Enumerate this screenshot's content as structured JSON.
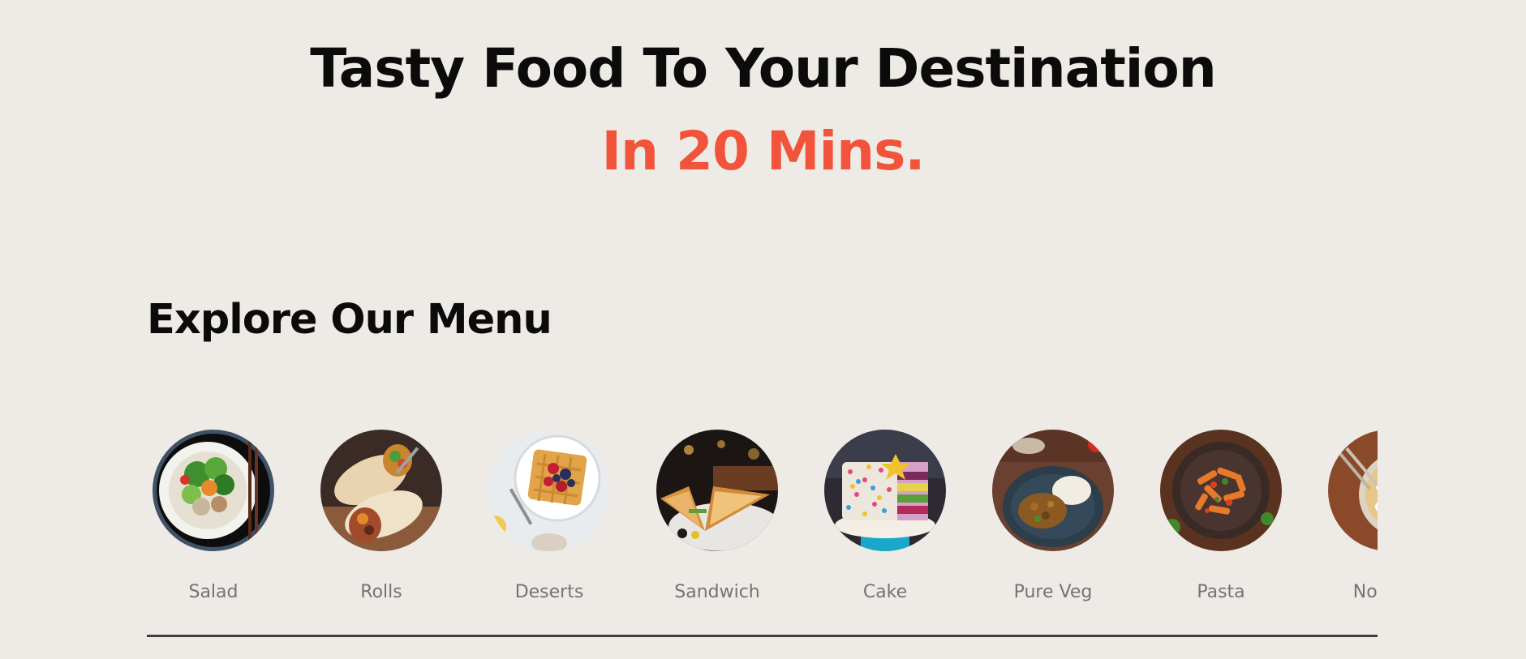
{
  "hero": {
    "line1": "Tasty Food To Your Destination",
    "line2": "In 20 Mins.",
    "accent_color": "#f1543a",
    "text_color": "#0b0b0b"
  },
  "menu": {
    "title": "Explore Our Menu",
    "items": [
      {
        "label": "Salad",
        "icon": "salad-bowl-icon"
      },
      {
        "label": "Rolls",
        "icon": "rolls-wrap-icon"
      },
      {
        "label": "Deserts",
        "icon": "waffle-dessert-icon"
      },
      {
        "label": "Sandwich",
        "icon": "sandwich-icon"
      },
      {
        "label": "Cake",
        "icon": "layer-cake-icon"
      },
      {
        "label": "Pure Veg",
        "icon": "veg-curry-plate-icon"
      },
      {
        "label": "Pasta",
        "icon": "pasta-bowl-icon"
      },
      {
        "label": "Noodles",
        "icon": "noodle-bowl-icon"
      }
    ],
    "label_color": "#747474",
    "divider_color": "#3e3e3e"
  },
  "page": {
    "background": "#eeebe7"
  }
}
